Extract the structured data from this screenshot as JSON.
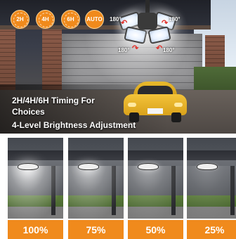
{
  "modes": {
    "timer_2h": "2H",
    "timer_4h": "4H",
    "timer_6h": "6H",
    "auto": "AUTO"
  },
  "rotation_angles": [
    "180°",
    "180°",
    "180°",
    "180°"
  ],
  "headline": {
    "line1": "2H/4H/6H Timing For",
    "line2": "Choices",
    "line3": "4-Level Brightness Adjustment"
  },
  "brightness_levels": [
    {
      "label": "100%",
      "level": 1.0
    },
    {
      "label": "75%",
      "level": 0.75
    },
    {
      "label": "50%",
      "level": 0.5
    },
    {
      "label": "25%",
      "level": 0.25
    }
  ],
  "colors": {
    "accent": "#f08a1c",
    "arrow": "#e0302a",
    "car": "#f3c33a"
  },
  "icons": [
    "timer-2h-icon",
    "timer-4h-icon",
    "timer-6h-icon",
    "auto-mode-icon",
    "rotation-arrow-icon"
  ]
}
